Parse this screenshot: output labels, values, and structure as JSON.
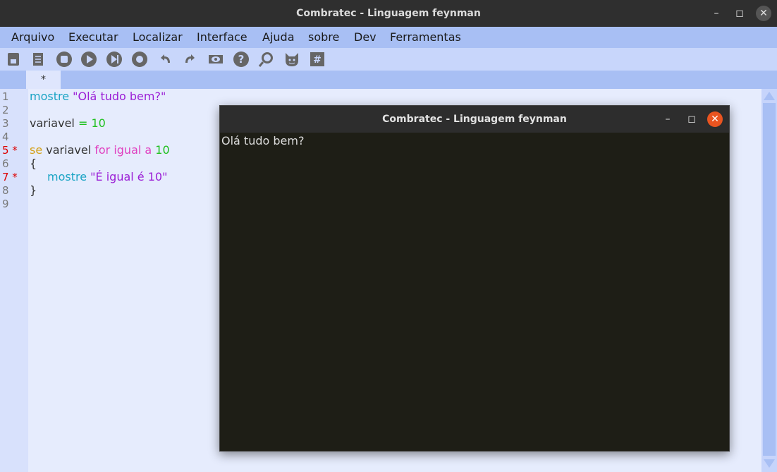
{
  "window": {
    "title": "Combratec - Linguagem feynman"
  },
  "menu": [
    "Arquivo",
    "Executar",
    "Localizar",
    "Interface",
    "Ajuda",
    "sobre",
    "Dev",
    "Ferramentas"
  ],
  "toolbar_icons": [
    "save-icon",
    "document-icon",
    "stop-icon",
    "play-icon",
    "step-icon",
    "record-icon",
    "undo-icon",
    "redo-icon",
    "eye-icon",
    "help-icon",
    "search-icon",
    "cat-icon",
    "hash-icon"
  ],
  "tab": {
    "label": "*"
  },
  "editor": {
    "lines": [
      {
        "num": "1",
        "err": false
      },
      {
        "num": "2",
        "err": false
      },
      {
        "num": "3",
        "err": false
      },
      {
        "num": "4",
        "err": false
      },
      {
        "num": "5 *",
        "err": true
      },
      {
        "num": "6",
        "err": false
      },
      {
        "num": "7 *",
        "err": true
      },
      {
        "num": "8",
        "err": false
      },
      {
        "num": "9",
        "err": false
      }
    ],
    "code": {
      "l1_kw": "mostre",
      "l1_str": "\"Olá tudo bem?\"",
      "l3_var": "variavel",
      "l3_eq": "=",
      "l3_num": "10",
      "l5_se": "se",
      "l5_var": "variavel",
      "l5_cond": "for igual a",
      "l5_num": "10",
      "l6": "{",
      "l7_kw": "mostre",
      "l7_str": "\"É igual é 10\"",
      "l8": "}"
    }
  },
  "popup": {
    "title": "Combratec - Linguagem feynman",
    "output": "Olá tudo bem?"
  }
}
